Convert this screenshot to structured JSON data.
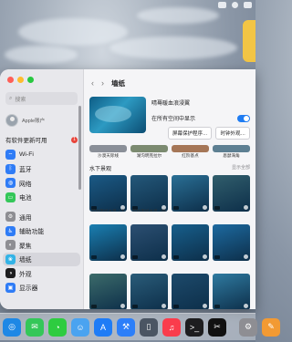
{
  "sidebar": {
    "search_placeholder": "搜索",
    "account_label": "Apple账户",
    "update_label": "有软件更新可用",
    "update_count": "1",
    "items": [
      {
        "label": "Wi-Fi",
        "icon": "wifi-icon",
        "color": "#2f7cf6"
      },
      {
        "label": "蓝牙",
        "icon": "bluetooth-icon",
        "color": "#2f7cf6"
      },
      {
        "label": "网络",
        "icon": "globe-icon",
        "color": "#2f7cf6"
      },
      {
        "label": "电池",
        "icon": "battery-icon",
        "color": "#34c759"
      },
      {
        "label": "通用",
        "icon": "gear-icon",
        "color": "#8e8e93"
      },
      {
        "label": "辅助功能",
        "icon": "accessibility-icon",
        "color": "#2f7cf6"
      },
      {
        "label": "聚焦",
        "icon": "spotlight-icon",
        "color": "#8e8e93"
      },
      {
        "label": "墙纸",
        "icon": "wallpaper-icon",
        "color": "#33b3e6"
      },
      {
        "label": "外观",
        "icon": "appearance-icon",
        "color": "#1d1d1f"
      },
      {
        "label": "显示器",
        "icon": "display-icon",
        "color": "#2f7cf6"
      }
    ]
  },
  "main": {
    "title": "墙纸",
    "current_name": "晴蓦暖血浪浸翼",
    "show_all_spaces_label": "在所有空间中显示",
    "screensaver_button": "屏幕保护程序…",
    "clock_button": "时钟外观…",
    "top_row_labels": [
      "沙漠天际线",
      "湖沟明克拉尔",
      "红阶基点",
      "恩瑟海角"
    ],
    "section_title": "水下景观",
    "show_more": "显示全部",
    "grid": [
      {
        "label": "阿拉斯加水母（卡瓦）",
        "color": "#1b5a86"
      },
      {
        "label": "阿拉斯加水母（幽光）",
        "color": "#24587a"
      },
      {
        "label": "加州海狮游",
        "color": "#2a6f95"
      },
      {
        "label": "加州海带森林",
        "color": "#315e6c"
      },
      {
        "label": "巴哈海湾鱼群",
        "color": "#1a7fb2"
      },
      {
        "label": "鱼群",
        "color": "#2c4f72"
      },
      {
        "label": "海底鲸",
        "color": "#175f8c"
      },
      {
        "label": "帕劳珊瑚（礁岩）",
        "color": "#1d6aa0"
      },
      {
        "label": "珊瑚礁",
        "color": "#3c6b6a"
      },
      {
        "label": "帕劳水母（海湾）",
        "color": "#2a5c79"
      },
      {
        "label": "帕劳水母（深海）",
        "color": "#1d4a6b"
      },
      {
        "label": "帕劳水母（浅滩）",
        "color": "#2f7aa0"
      }
    ]
  },
  "dock": [
    {
      "icon": "safari-icon",
      "color": "#1e88e5"
    },
    {
      "icon": "messages-icon",
      "color": "#34c759"
    },
    {
      "icon": "wechat-icon",
      "color": "#2ecc40"
    },
    {
      "icon": "finder-icon",
      "color": "#4aa3f0"
    },
    {
      "icon": "app-store-icon",
      "color": "#1f7cf6"
    },
    {
      "icon": "xcode-icon",
      "color": "#2d7ff9"
    },
    {
      "icon": "mirror-icon",
      "color": "#4b5563"
    },
    {
      "icon": "music-icon",
      "color": "#fa3c4c"
    },
    {
      "icon": "terminal-icon",
      "color": "#1d1d1f"
    },
    {
      "icon": "capcut-icon",
      "color": "#111111"
    },
    {
      "icon": "system-settings-icon",
      "color": "#8e8e93"
    },
    {
      "icon": "pages-icon",
      "color": "#f29a33"
    }
  ]
}
